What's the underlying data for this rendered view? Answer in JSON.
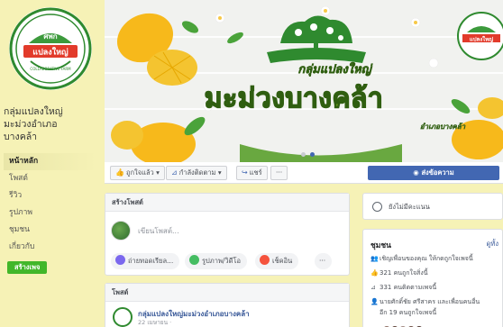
{
  "page": {
    "name_lines": [
      "กลุ่มแปลงใหญ่",
      "มะม่วงอำเภอ",
      "บางคล้า"
    ]
  },
  "logo": {
    "top_text": "ศพก",
    "banner_text": "แปลงใหญ่",
    "bottom_text": "COLLABORATIVE FARM"
  },
  "nav": {
    "items": [
      "หน้าหลัก",
      "โพสต์",
      "รีวิว",
      "รูปภาพ",
      "ชุมชน",
      "เกี่ยวกับ"
    ],
    "cta_label": "สร้างเพจ"
  },
  "cover": {
    "script_text": "กลุ่มแปลงใหญ่",
    "title": "มะม่วงบางคล้า",
    "subtitle": "อำเภอบางคล้า",
    "logo_text": "แปลงใหญ่"
  },
  "actions": {
    "liked_label": "ถูกใจแล้ว",
    "following_label": "กำลังติดตาม",
    "share_label": "แชร์",
    "more_label": "···",
    "send_message_label": "ส่งข้อความ"
  },
  "create_post": {
    "title": "สร้างโพสต์",
    "placeholder": "เขียนโพสต์...",
    "pills": [
      "ถ่ายทอดเรียล...",
      "รูปภาพ/วิดีโอ",
      "เช็คอิน",
      "···"
    ]
  },
  "posts": {
    "title": "โพสต์",
    "author": "กลุ่มแปลงใหญ่มะม่วงอำเภอบางคล้า",
    "date": "22 เมษายน ·"
  },
  "status": {
    "text": "ยังไม่มีคะแนน"
  },
  "community": {
    "title": "ชุมชน",
    "see_all": "ดูทั้ง",
    "rows": [
      "เชิญเพื่อนของคุณ ให้กดถูกใจเพจนี้",
      "321 คนถูกใจสิ่งนี้",
      "331 คนติดตามเพจนี้",
      "นายศักดิ์ชัย ศรีสาคร และเพื่อนคนอื่น",
      "อีก 19 คนถูกใจเพจนี้"
    ]
  },
  "colors": {
    "page_bg": "#f6f2b6",
    "fb_blue": "#4267b2",
    "cta_green": "#42b72a",
    "brand_green": "#2f8a2f",
    "mango_yellow": "#f7b91b"
  }
}
